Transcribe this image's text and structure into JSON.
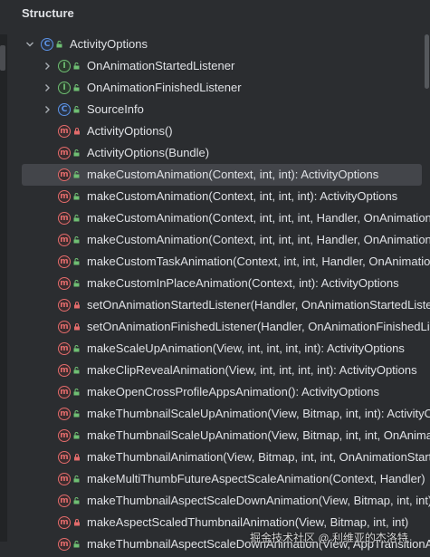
{
  "panel": {
    "title": "Structure"
  },
  "rows": [
    {
      "indent": 0,
      "expander": "expanded",
      "kind": "c",
      "access": "public",
      "label": "ActivityOptions"
    },
    {
      "indent": 1,
      "expander": "collapsed",
      "kind": "i",
      "access": "public",
      "label": "OnAnimationStartedListener"
    },
    {
      "indent": 1,
      "expander": "collapsed",
      "kind": "i",
      "access": "public",
      "label": "OnAnimationFinishedListener"
    },
    {
      "indent": 1,
      "expander": "collapsed",
      "kind": "c",
      "access": "public",
      "label": "SourceInfo"
    },
    {
      "indent": 1,
      "expander": "none",
      "kind": "m",
      "access": "private",
      "label": "ActivityOptions()"
    },
    {
      "indent": 1,
      "expander": "none",
      "kind": "m",
      "access": "public",
      "label": "ActivityOptions(Bundle)"
    },
    {
      "indent": 1,
      "expander": "none",
      "kind": "m",
      "access": "public",
      "label": "makeCustomAnimation(Context, int, int): ActivityOptions",
      "selected": true
    },
    {
      "indent": 1,
      "expander": "none",
      "kind": "m",
      "access": "public",
      "label": "makeCustomAnimation(Context, int, int, int): ActivityOptions"
    },
    {
      "indent": 1,
      "expander": "none",
      "kind": "m",
      "access": "public",
      "label": "makeCustomAnimation(Context, int, int, int, Handler, OnAnimationStartedListener)"
    },
    {
      "indent": 1,
      "expander": "none",
      "kind": "m",
      "access": "public",
      "label": "makeCustomAnimation(Context, int, int, int, Handler, OnAnimationStartedListener)"
    },
    {
      "indent": 1,
      "expander": "none",
      "kind": "m",
      "access": "public",
      "label": "makeCustomTaskAnimation(Context, int, int, Handler, OnAnimationStartedListener)"
    },
    {
      "indent": 1,
      "expander": "none",
      "kind": "m",
      "access": "public",
      "label": "makeCustomInPlaceAnimation(Context, int): ActivityOptions"
    },
    {
      "indent": 1,
      "expander": "none",
      "kind": "m",
      "access": "private",
      "label": "setOnAnimationStartedListener(Handler, OnAnimationStartedListener)"
    },
    {
      "indent": 1,
      "expander": "none",
      "kind": "m",
      "access": "private",
      "label": "setOnAnimationFinishedListener(Handler, OnAnimationFinishedListener)"
    },
    {
      "indent": 1,
      "expander": "none",
      "kind": "m",
      "access": "public",
      "label": "makeScaleUpAnimation(View, int, int, int, int): ActivityOptions"
    },
    {
      "indent": 1,
      "expander": "none",
      "kind": "m",
      "access": "public",
      "label": "makeClipRevealAnimation(View, int, int, int, int): ActivityOptions"
    },
    {
      "indent": 1,
      "expander": "none",
      "kind": "m",
      "access": "public",
      "label": "makeOpenCrossProfileAppsAnimation(): ActivityOptions"
    },
    {
      "indent": 1,
      "expander": "none",
      "kind": "m",
      "access": "public",
      "label": "makeThumbnailScaleUpAnimation(View, Bitmap, int, int): ActivityOptions"
    },
    {
      "indent": 1,
      "expander": "none",
      "kind": "m",
      "access": "public",
      "label": "makeThumbnailScaleUpAnimation(View, Bitmap, int, int, OnAnimationStartedListener)"
    },
    {
      "indent": 1,
      "expander": "none",
      "kind": "m",
      "access": "private",
      "label": "makeThumbnailAnimation(View, Bitmap, int, int, OnAnimationStartedListener)"
    },
    {
      "indent": 1,
      "expander": "none",
      "kind": "m",
      "access": "public",
      "label": "makeMultiThumbFutureAspectScaleAnimation(Context, Handler)"
    },
    {
      "indent": 1,
      "expander": "none",
      "kind": "m",
      "access": "public",
      "label": "makeThumbnailAspectScaleDownAnimation(View, Bitmap, int, int)"
    },
    {
      "indent": 1,
      "expander": "none",
      "kind": "m",
      "access": "private",
      "label": "makeAspectScaledThumbnailAnimation(View, Bitmap, int, int)"
    },
    {
      "indent": 1,
      "expander": "none",
      "kind": "m",
      "access": "public",
      "label": "makeThumbnailAspectScaleDownAnimation(View, AppTransitionAnimationSpec[])"
    }
  ],
  "watermark": "掘金技术社区 @ 利维亚的杰洛特",
  "colors": {
    "background": "#2b2d30",
    "selected": "#43454a",
    "method_icon": "#e26b6b",
    "interface_icon": "#6fbf73",
    "class_icon": "#5c93e6",
    "public_unlock": "#6fbf73",
    "private_lock": "#e26b6b"
  }
}
